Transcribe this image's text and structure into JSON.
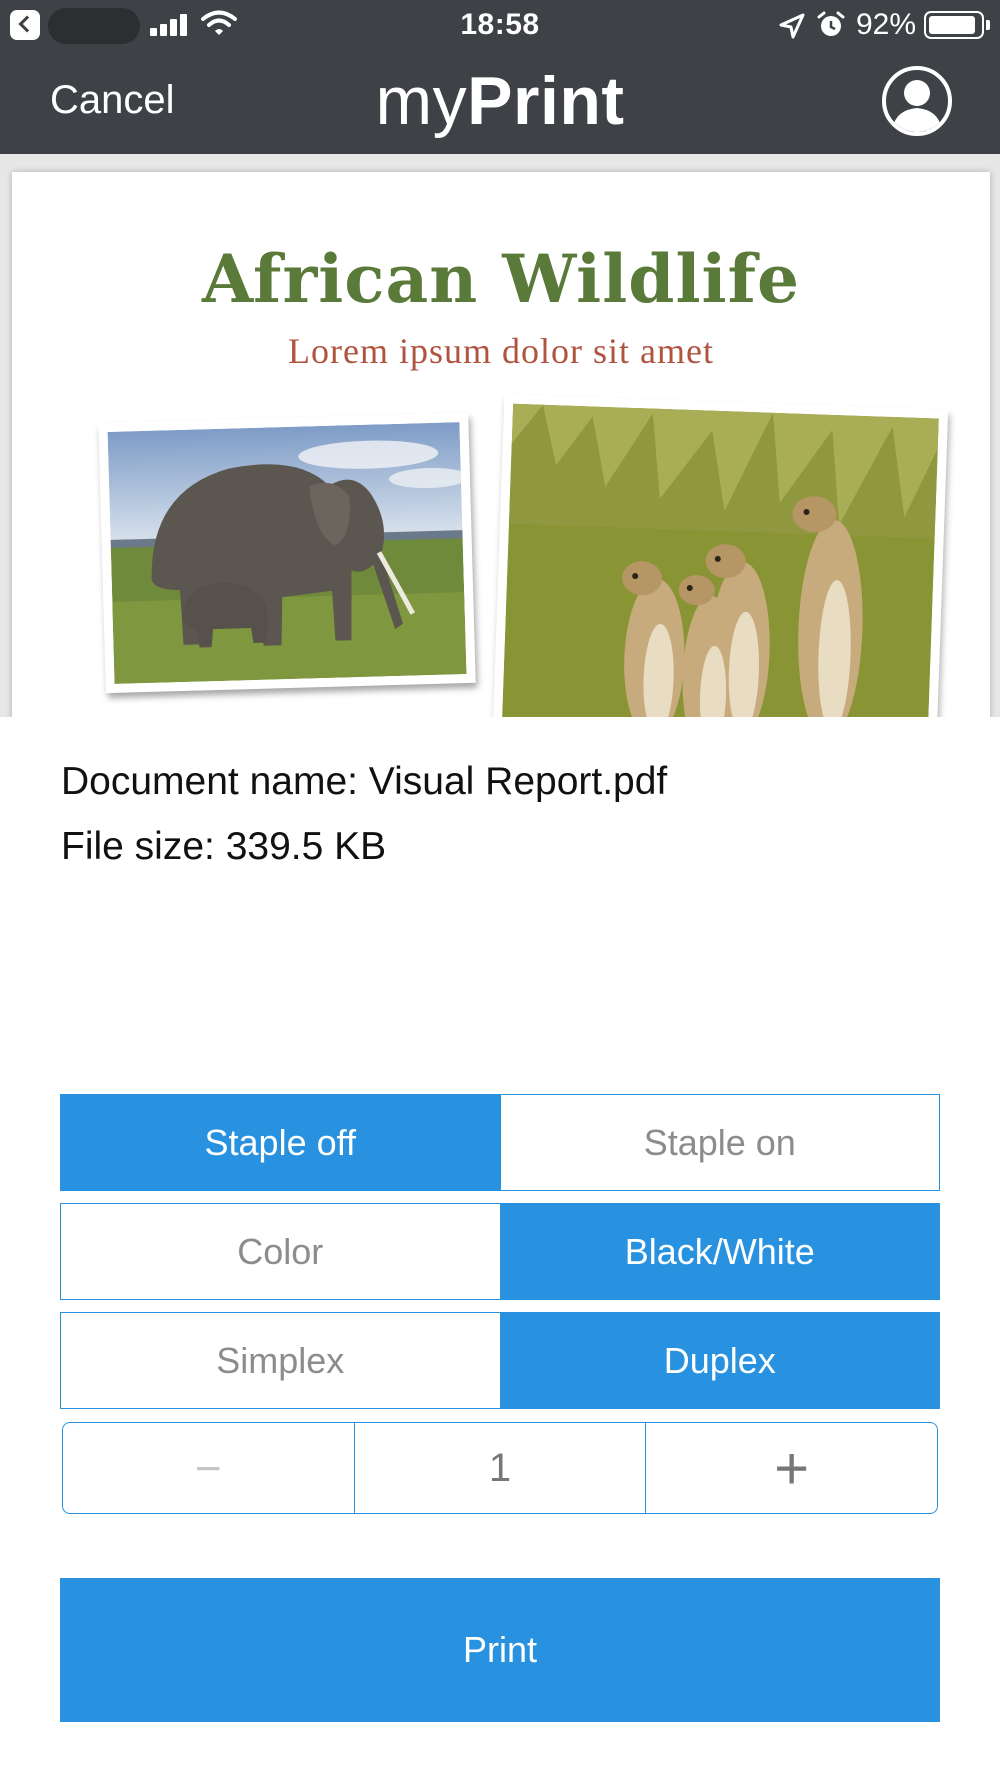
{
  "status_bar": {
    "time": "18:58",
    "battery": "92%"
  },
  "nav": {
    "cancel_label": "Cancel",
    "title_light": "my",
    "title_bold": "Print",
    "avatar_icon": "user-avatar-icon"
  },
  "preview": {
    "title": "African Wildlife",
    "subtitle": "Lorem ipsum dolor sit amet",
    "photos": [
      "elephant-photo",
      "meerkats-photo"
    ]
  },
  "document": {
    "name_line": "Document name: Visual Report.pdf",
    "size_line": "File size: 339.5 KB"
  },
  "options": {
    "staple": {
      "off_label": "Staple off",
      "on_label": "Staple on",
      "selected": "Staple off"
    },
    "color": {
      "color_label": "Color",
      "bw_label": "Black/White",
      "selected": "Black/White"
    },
    "sides": {
      "simplex_label": "Simplex",
      "duplex_label": "Duplex",
      "selected": "Duplex"
    }
  },
  "copies": {
    "minus_label": "−",
    "value": "1",
    "plus_label": "+"
  },
  "print_label": "Print",
  "colors": {
    "accent": "#2892e0",
    "header": "#3e4145",
    "doc_title": "#5a7a3a",
    "doc_subtitle": "#b0533f"
  }
}
